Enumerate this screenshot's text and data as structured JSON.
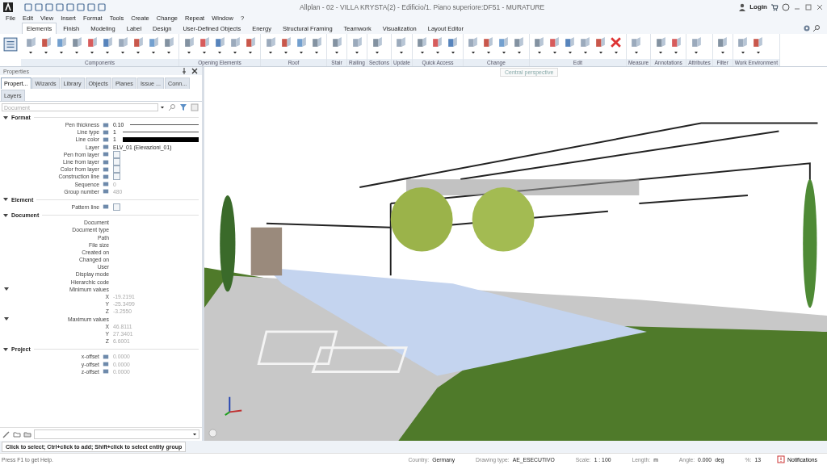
{
  "window": {
    "title": "Allplan - 02 - VILLA KRYSTA(2) - Edificio/1. Piano superiore:DF51 - MURATURE",
    "login": "Login"
  },
  "menu": [
    "File",
    "Edit",
    "View",
    "Insert",
    "Format",
    "Tools",
    "Create",
    "Change",
    "Repeat",
    "Window",
    "?"
  ],
  "ribbon_tabs": [
    {
      "label": "Elements",
      "selected": true
    },
    {
      "label": "Finish",
      "selected": false
    },
    {
      "label": "Modeling",
      "selected": false
    },
    {
      "label": "Label",
      "selected": false
    },
    {
      "label": "Design",
      "selected": false
    },
    {
      "label": "User-Defined Objects",
      "selected": false
    },
    {
      "label": "Energy",
      "selected": false
    },
    {
      "label": "Structural Framing",
      "selected": false
    },
    {
      "label": "Teamwork",
      "selected": false
    },
    {
      "label": "Visualization",
      "selected": false
    },
    {
      "label": "Layout Editor",
      "selected": false
    }
  ],
  "ribbon_groups": [
    "Components",
    "Opening Elements",
    "Roof",
    "Stair",
    "Railing",
    "Sections",
    "Update",
    "Quick Access",
    "Change",
    "Edit",
    "Measure",
    "Annotations",
    "Attributes",
    "Filter",
    "Work Environment"
  ],
  "tooltip": "Central perspective",
  "properties": {
    "title": "Properties",
    "tabs": [
      {
        "label": "Propert...",
        "selected": true
      },
      {
        "label": "Wizards",
        "selected": false
      },
      {
        "label": "Library",
        "selected": false
      },
      {
        "label": "Objects",
        "selected": false
      },
      {
        "label": "Planes",
        "selected": false
      },
      {
        "label": "Issue ...",
        "selected": false
      },
      {
        "label": "Conn...",
        "selected": false
      },
      {
        "label": "Layers",
        "selected": false
      }
    ],
    "filter": {
      "placeholder": "Document"
    },
    "sections": [
      {
        "title": "Format",
        "rows": [
          {
            "kind": "line",
            "label": "Pen thickness",
            "value": "0.10"
          },
          {
            "kind": "line",
            "label": "Line type",
            "value": "1"
          },
          {
            "kind": "color",
            "label": "Line color",
            "value": "1",
            "color": "#000000"
          },
          {
            "kind": "text",
            "label": "Layer",
            "value": "ELV_01 (Elevazioni_01)",
            "disabled": false
          },
          {
            "kind": "checkbox",
            "label": "Pen from layer",
            "checked": false
          },
          {
            "kind": "checkbox",
            "label": "Line from layer",
            "checked": false
          },
          {
            "kind": "checkbox",
            "label": "Color from layer",
            "checked": false
          },
          {
            "kind": "checkbox",
            "label": "Construction line",
            "checked": false
          },
          {
            "kind": "text",
            "label": "Sequence",
            "value": "0",
            "disabled": true
          },
          {
            "kind": "text",
            "label": "Group number",
            "value": "480",
            "disabled": true
          }
        ]
      },
      {
        "title": "Element",
        "rows": [
          {
            "kind": "checkbox",
            "label": "Pattern line",
            "checked": false
          }
        ]
      },
      {
        "title": "Document",
        "rows": [
          {
            "kind": "plain",
            "label": "Document"
          },
          {
            "kind": "plain",
            "label": "Document type"
          },
          {
            "kind": "plain",
            "label": "Path"
          },
          {
            "kind": "plain",
            "label": "File size"
          },
          {
            "kind": "plain",
            "label": "Created on"
          },
          {
            "kind": "plain",
            "label": "Changed on"
          },
          {
            "kind": "plain",
            "label": "User"
          },
          {
            "kind": "plain",
            "label": "Display mode"
          },
          {
            "kind": "plain",
            "label": "Hierarchic code"
          },
          {
            "kind": "group",
            "label": "Minimum values",
            "children": [
              {
                "label": "X",
                "value": "-19.2191"
              },
              {
                "label": "Y",
                "value": "-25.3499"
              },
              {
                "label": "Z",
                "value": "-3.2550"
              }
            ]
          },
          {
            "kind": "group",
            "label": "Maximum values",
            "children": [
              {
                "label": "X",
                "value": "46.8111"
              },
              {
                "label": "Y",
                "value": "27.3401"
              },
              {
                "label": "Z",
                "value": "6.6001"
              }
            ]
          }
        ]
      },
      {
        "title": "Project",
        "rows": [
          {
            "kind": "text",
            "label": "x-offset",
            "value": "0.0000",
            "disabled": true
          },
          {
            "kind": "text",
            "label": "y-offset",
            "value": "0.0000",
            "disabled": true
          },
          {
            "kind": "text",
            "label": "z-offset",
            "value": "0.0000",
            "disabled": true
          }
        ]
      }
    ]
  },
  "command_hint": "Click to select; Ctrl+click to add; Shift+click to select entity group",
  "status_bar": {
    "help": "Press F1 to get Help.",
    "fields": [
      {
        "label": "Country:",
        "value": "Germany"
      },
      {
        "label": "Drawing type:",
        "value": "AE_ESECUTIVO"
      },
      {
        "label": "Scale:",
        "value": "1 : 100"
      },
      {
        "label": "Length:",
        "value": "m"
      },
      {
        "label": "Angle:",
        "value": "0.000"
      },
      {
        "value": "deg"
      },
      {
        "label": "%:",
        "value": "13"
      }
    ],
    "notifications": "Notifications"
  }
}
